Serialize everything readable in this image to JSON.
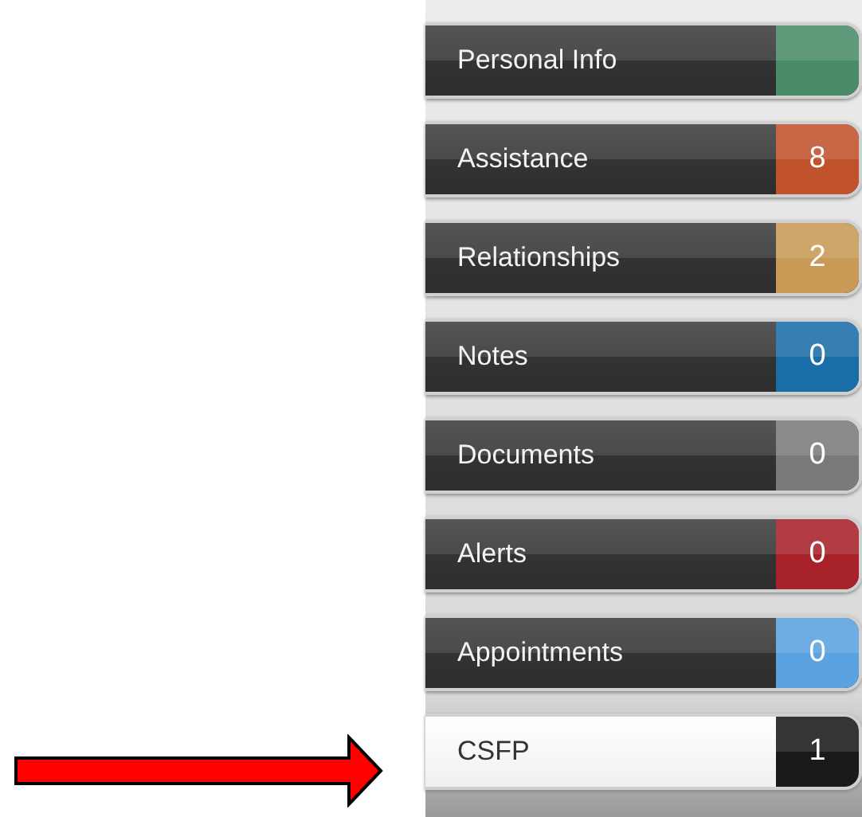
{
  "tabs": [
    {
      "label": "Personal Info",
      "color": "#4a8c68",
      "selected": false
    },
    {
      "label": "Assistance",
      "count": "8",
      "color": "#c0522c",
      "selected": false
    },
    {
      "label": "Relationships",
      "count": "2",
      "color": "#c99a56",
      "selected": false
    },
    {
      "label": "Notes",
      "count": "0",
      "color": "#1a6ea8",
      "selected": false
    },
    {
      "label": "Documents",
      "count": "0",
      "color": "#7a7a7a",
      "selected": false
    },
    {
      "label": "Alerts",
      "count": "0",
      "color": "#a8222a",
      "selected": false
    },
    {
      "label": "Appointments",
      "count": "0",
      "color": "#5aa2e0",
      "selected": false
    },
    {
      "label": "CSFP",
      "count": "1",
      "color": "#1a1a1a",
      "selected": true
    }
  ]
}
